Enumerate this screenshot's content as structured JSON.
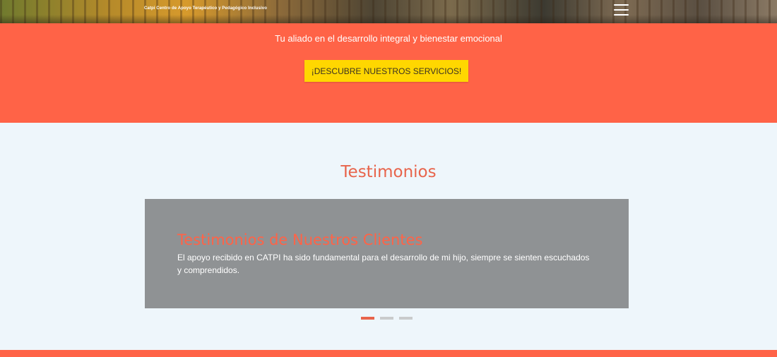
{
  "header": {
    "brand": "Catpi Centro de Apoyo Terapéutico y Pedagógico Inclusivo",
    "menu_icon": "hamburger-menu-icon"
  },
  "hero": {
    "tagline": "Tu aliado en el desarrollo integral y bienestar emocional",
    "cta_label": "¡DESCUBRE NUESTROS SERVICIOS!"
  },
  "testimonials": {
    "section_title": "Testimonios",
    "slides": [
      {
        "title": "Testimonios de Nuestros Clientes",
        "text": "El apoyo recibido en CATPI ha sido fundamental para el desarrollo de mi hijo, siempre se sienten escuchados y comprendidos."
      }
    ],
    "active_slide": 1,
    "slide_count": 3
  },
  "colors": {
    "accent": "#ff6347",
    "cta": "#ffd700",
    "section_bg": "#eef6fb",
    "slide_bg": "#8f9294"
  }
}
